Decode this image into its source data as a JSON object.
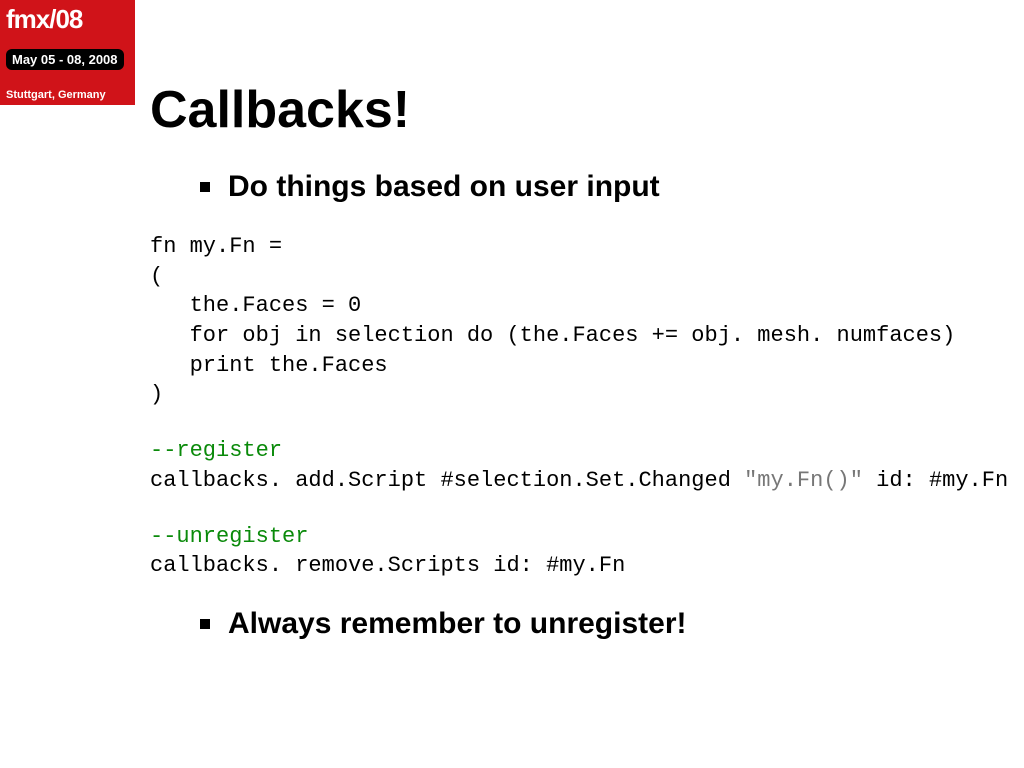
{
  "logo": {
    "brand": "fmx/08",
    "dates": "May 05 - 08, 2008",
    "location": "Stuttgart, Germany"
  },
  "slide": {
    "title": "Callbacks!",
    "bullet1": "Do things based on user input",
    "code_block1_l1": "fn my.Fn =",
    "code_block1_l2": "(",
    "code_block1_l3": "   the.Faces = 0",
    "code_block1_l4": "   for obj in selection do (the.Faces += obj. mesh. numfaces)",
    "code_block1_l5": "   print the.Faces",
    "code_block1_l6": ")",
    "code_reg_comment": "--register",
    "code_reg_line_a": "callbacks. add.Script #selection.Set.Changed ",
    "code_reg_line_str": "\"my.Fn()\"",
    "code_reg_line_b": " id: #my.Fn",
    "code_unreg_comment": "--unregister",
    "code_unreg_line": "callbacks. remove.Scripts id: #my.Fn",
    "bullet2": "Always remember to unregister!"
  }
}
